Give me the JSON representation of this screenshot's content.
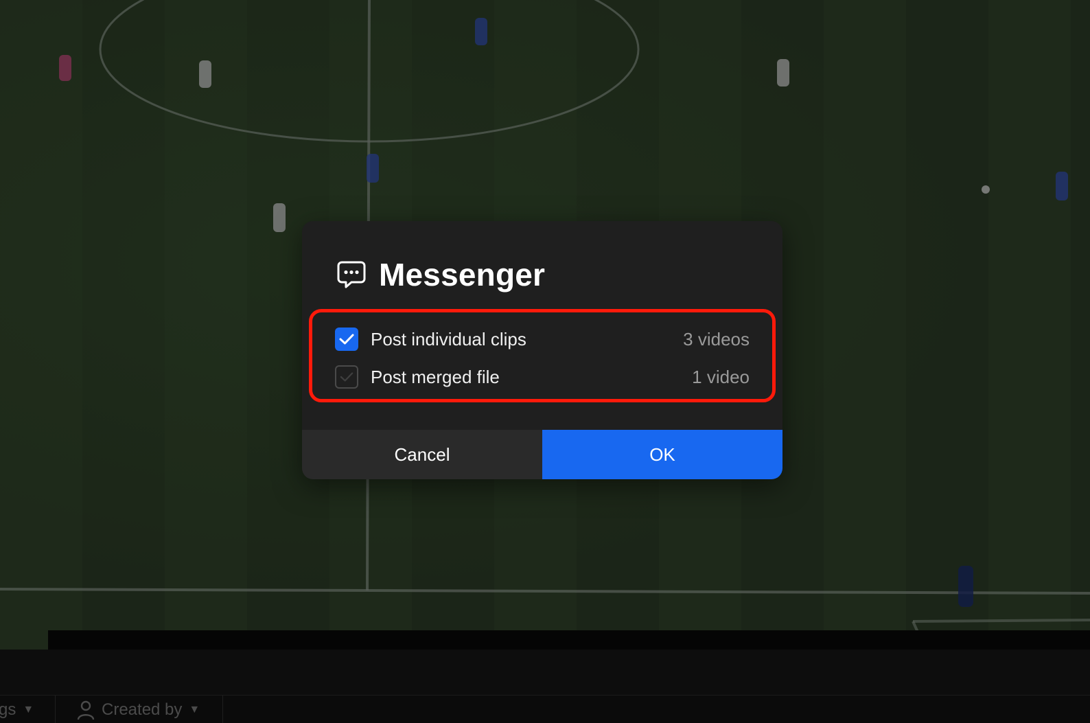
{
  "dialog": {
    "title": "Messenger",
    "icon": "chat-bubble-dots-icon",
    "options": [
      {
        "label": "Post individual clips",
        "count": "3 videos",
        "checked": true
      },
      {
        "label": "Post merged file",
        "count": "1 video",
        "checked": false
      }
    ],
    "cancel_label": "Cancel",
    "ok_label": "OK",
    "accent_color": "#1868f0",
    "highlight_color": "#ff1a0a"
  },
  "filters": [
    {
      "label": "gs",
      "icon": "tag-icon"
    },
    {
      "label": "Created by",
      "icon": "person-icon"
    }
  ]
}
